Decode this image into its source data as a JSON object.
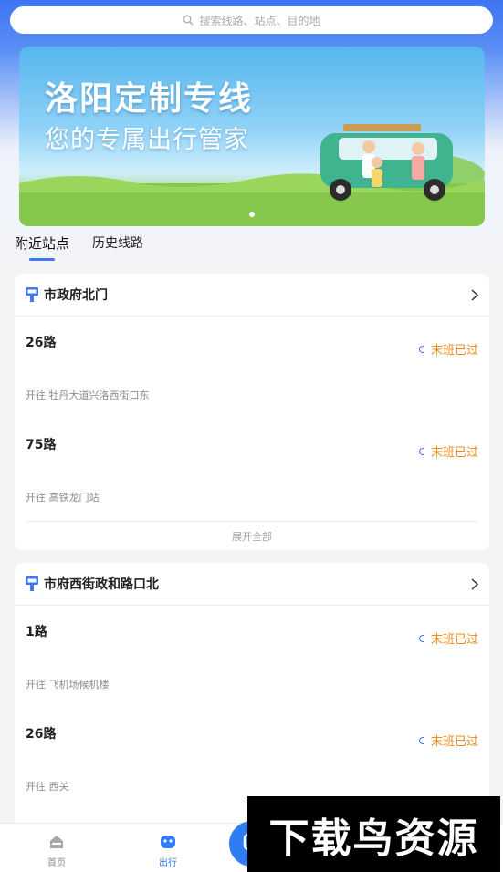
{
  "search": {
    "placeholder": "搜索线路、站点、目的地"
  },
  "banner": {
    "title": "洛阳定制专线",
    "subtitle": "您的专属出行管家"
  },
  "tabs": [
    {
      "label": "附近站点"
    },
    {
      "label": "历史线路"
    }
  ],
  "stations": [
    {
      "name": "市政府北门",
      "routes": [
        {
          "name": "26路",
          "status": "末班已过",
          "direction": "开往 牡丹大道兴洛西街口东"
        },
        {
          "name": "75路",
          "status": "末班已过",
          "direction": "开往 高铁龙门站"
        }
      ],
      "expand_label": "展开全部"
    },
    {
      "name": "市府西街政和路口北",
      "routes": [
        {
          "name": "1路",
          "status": "末班已过",
          "direction": "开往 飞机场候机楼"
        },
        {
          "name": "26路",
          "status": "末班已过",
          "direction": "开往 西关"
        }
      ]
    }
  ],
  "tabbar": {
    "home": "首页",
    "travel": "出行",
    "center_icon": "bus-icon"
  },
  "watermark": "下载鸟资源",
  "colors": {
    "accent": "#3f78f2",
    "status": "#f08a1c",
    "active_tab": "#2f7df0"
  }
}
